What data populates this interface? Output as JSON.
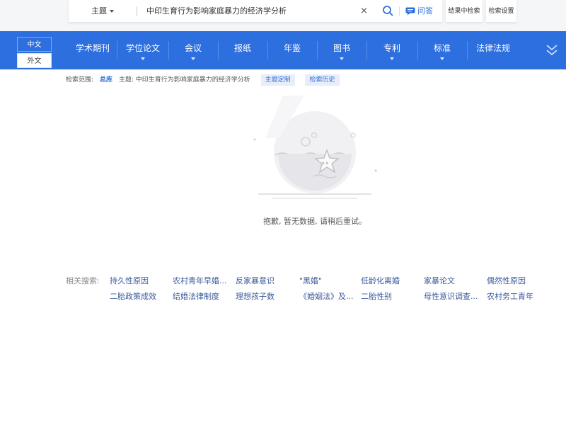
{
  "search": {
    "scope_label": "主题",
    "query": "中印生育行为影响家庭暴力的经济学分析",
    "clear_symbol": "×",
    "qa_label": "问答",
    "within_label": "结果中检索",
    "settings_label": "检索设置"
  },
  "nav": {
    "lang_active": "中文",
    "lang_other": "外文",
    "items": [
      {
        "label": "学术期刊",
        "dropdown": false
      },
      {
        "label": "学位论文",
        "dropdown": true
      },
      {
        "label": "会议",
        "dropdown": true
      },
      {
        "label": "报纸",
        "dropdown": false
      },
      {
        "label": "年鉴",
        "dropdown": false
      },
      {
        "label": "图书",
        "dropdown": true
      },
      {
        "label": "专利",
        "dropdown": true
      },
      {
        "label": "标准",
        "dropdown": true
      },
      {
        "label": "法律法规",
        "dropdown": false
      }
    ]
  },
  "crumbs": {
    "scope_prefix": "检索范围:",
    "library": "总库",
    "topic": "主题: 中印生育行为影响家庭暴力的经济学分析",
    "customize": "主题定制",
    "history": "检索历史"
  },
  "empty": {
    "message": "抱歉, 暂无数据, 请稍后重试。"
  },
  "related": {
    "label": "相关搜索:",
    "items": [
      "持久性原因",
      "农村青年早婚...",
      "反家暴意识",
      "\"黑婚\"",
      "低龄化离婚",
      "家暴论文",
      "偶然性原因",
      "二胎政策成效",
      "结婚法律制度",
      "理想孩子数",
      "《婚姻法》及...",
      "二胎性别",
      "母性意识调查...",
      "农村务工青年"
    ]
  },
  "colors": {
    "nav_bg": "#2e6fe0",
    "link": "#2e6fd9"
  }
}
